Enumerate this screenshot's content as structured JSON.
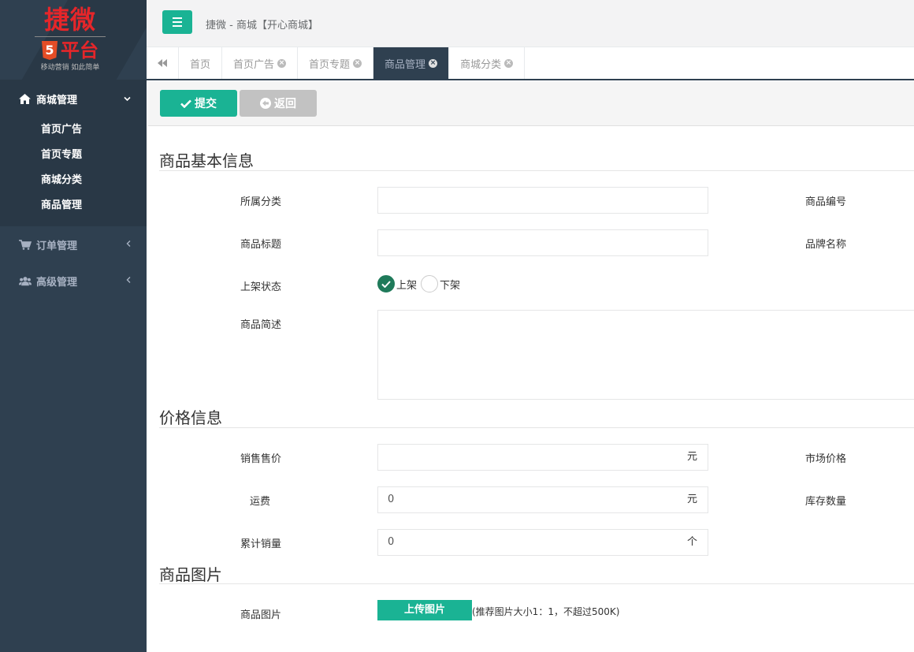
{
  "logo": {
    "title": "捷微",
    "five": "5",
    "sub": "平台",
    "slogan": "移动营销 如此简单"
  },
  "sidebar": {
    "groups": [
      {
        "label": "商城管理",
        "icon": "home-icon",
        "expanded": true,
        "items": [
          "首页广告",
          "首页专题",
          "商城分类",
          "商品管理"
        ]
      },
      {
        "label": "订单管理",
        "icon": "cart-icon",
        "expanded": false
      },
      {
        "label": "高级管理",
        "icon": "users-icon",
        "expanded": false
      }
    ]
  },
  "header": {
    "breadcrumb": "捷微 - 商城【开心商城】"
  },
  "tabs": [
    {
      "label": "首页",
      "closable": false,
      "active": false
    },
    {
      "label": "首页广告",
      "closable": true,
      "active": false
    },
    {
      "label": "首页专题",
      "closable": true,
      "active": false
    },
    {
      "label": "商品管理",
      "closable": true,
      "active": true
    },
    {
      "label": "商城分类",
      "closable": true,
      "active": false
    }
  ],
  "toolbar": {
    "submit_label": "提交",
    "back_label": "返回"
  },
  "form": {
    "basic": {
      "title": "商品基本信息",
      "category_label": "所属分类",
      "category_value": "",
      "code_label": "商品编号",
      "title_label": "商品标题",
      "title_value": "",
      "brand_label": "品牌名称",
      "status_label": "上架状态",
      "status_on": "上架",
      "status_off": "下架",
      "desc_label": "商品简述"
    },
    "price": {
      "title": "价格信息",
      "sale_label": "销售售价",
      "sale_value": "",
      "sale_unit": "元",
      "market_label": "市场价格",
      "freight_label": "运费",
      "freight_value": "0",
      "freight_unit": "元",
      "stock_label": "库存数量",
      "sold_label": "累计销量",
      "sold_value": "0",
      "sold_unit": "个"
    },
    "image": {
      "title": "商品图片",
      "image_label": "商品图片",
      "upload_label": "上传图片",
      "hint": "(推荐图片大小1：1，不超过500K)"
    }
  },
  "colors": {
    "accent": "#1ab394",
    "sidebar": "#2f4050",
    "logo_red": "#e5262a"
  }
}
